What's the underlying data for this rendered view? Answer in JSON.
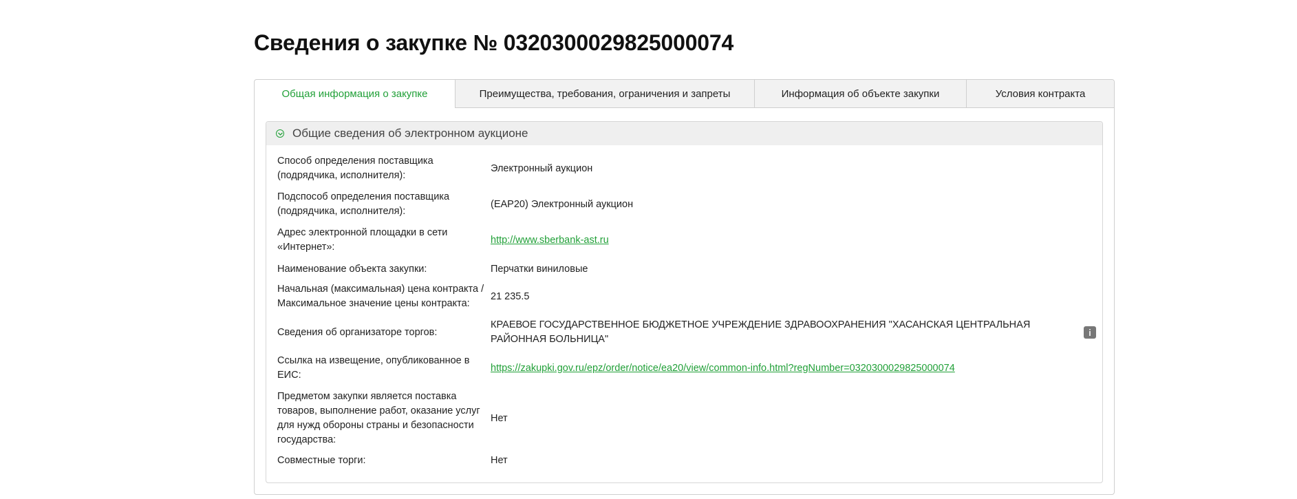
{
  "page": {
    "title": "Сведения о закупке № 0320300029825000074"
  },
  "tabs": [
    {
      "label": "Общая информация о закупке",
      "active": true
    },
    {
      "label": "Преимущества, требования, ограничения и запреты",
      "active": false
    },
    {
      "label": "Информация об объекте закупки",
      "active": false
    },
    {
      "label": "Условия контракта",
      "active": false
    }
  ],
  "section": {
    "title": "Общие сведения об электронном аукционе",
    "icon": "collapse-circle-icon",
    "rows": [
      {
        "label": "Способ определения поставщика (подрядчика, исполнителя):",
        "value": "Электронный аукцион"
      },
      {
        "label": "Подспособ определения поставщика (подрядчика, исполнителя):",
        "value": "(ЕАР20) Электронный аукцион"
      },
      {
        "label": "Адрес электронной площадки в сети «Интернет»:",
        "value": "http://www.sberbank-ast.ru"
      },
      {
        "label": "Наименование объекта закупки:",
        "value": "Перчатки виниловые"
      },
      {
        "label": "Начальная (максимальная) цена контракта / Максимальное значение цены контракта:",
        "value": "21 235.5"
      },
      {
        "label": "Сведения об организаторе торгов:",
        "value": "КРАЕВОЕ ГОСУДАРСТВЕННОЕ БЮДЖЕТНОЕ УЧРЕЖДЕНИЕ ЗДРАВООХРАНЕНИЯ \"ХАСАНСКАЯ ЦЕНТРАЛЬНАЯ РАЙОННАЯ БОЛЬНИЦА\""
      },
      {
        "label": "Ссылка на извещение, опубликованное в ЕИС:",
        "value": "https://zakupki.gov.ru/epz/order/notice/ea20/view/common-info.html?regNumber=0320300029825000074"
      },
      {
        "label": "Предметом закупки является поставка товаров, выполнение работ, оказание услуг для нужд обороны страны и безопасности государства:",
        "value": "Нет"
      },
      {
        "label": "Совместные торги:",
        "value": "Нет"
      }
    ]
  },
  "colors": {
    "accent": "#21a038",
    "tab_bg": "#f2f2f2",
    "header_bg": "#efefef",
    "info_icon_bg": "#777777"
  }
}
